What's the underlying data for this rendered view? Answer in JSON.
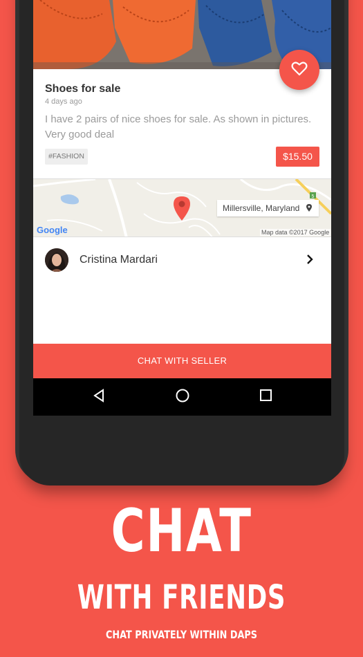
{
  "listing": {
    "title": "Shoes for sale",
    "posted": "4 days ago",
    "description": "I have 2 pairs of nice shoes for sale. As shown in pictures. Very good deal",
    "tag": "#FASHION",
    "price": "$15.50"
  },
  "map": {
    "location": "Millersville, Maryland",
    "attribution": "Map data ©2017 Google",
    "logo": "Google",
    "route_badge": "5"
  },
  "seller": {
    "name": "Cristina Mardari"
  },
  "actions": {
    "chat_label": "CHAT WITH SELLER"
  },
  "promo": {
    "headline": "CHAT",
    "subheadline": "WITH FRIENDS",
    "tagline": "CHAT PRIVATELY WITHIN DAPS"
  },
  "colors": {
    "accent": "#f4554a",
    "background": "#f4554a"
  },
  "icons": [
    "heart-icon",
    "location-pin-icon",
    "chevron-right-icon",
    "back-icon",
    "home-icon",
    "recents-icon"
  ]
}
